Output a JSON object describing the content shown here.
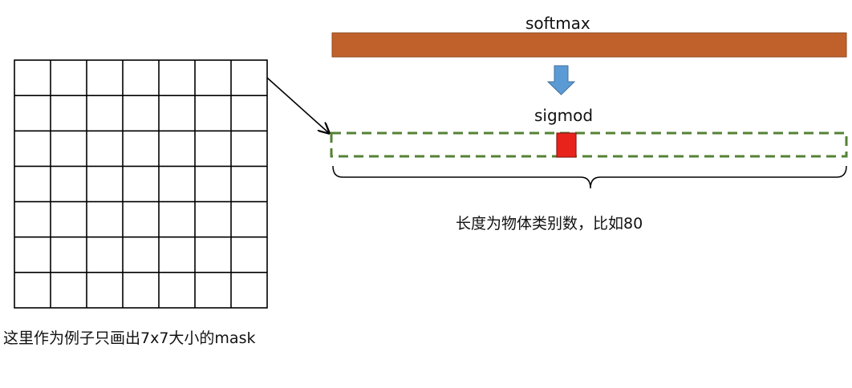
{
  "labels": {
    "softmax": "softmax",
    "sigmoid": "sigmod",
    "class_length": "长度为物体类别数，比如80",
    "mask_caption": "这里作为例子只画出7x7大小的mask"
  },
  "mask_grid": {
    "rows": 7,
    "cols": 7
  },
  "colors": {
    "softmax_bar": "#c0612b",
    "softmax_bar_border": "#8f4a22",
    "down_arrow": "#5b9bd5",
    "down_arrow_border": "#41719c",
    "sigmoid_box_border": "#548235",
    "highlight_cell": "#e8231c",
    "highlight_cell_border": "#8b1a12",
    "lines": "#000000"
  }
}
